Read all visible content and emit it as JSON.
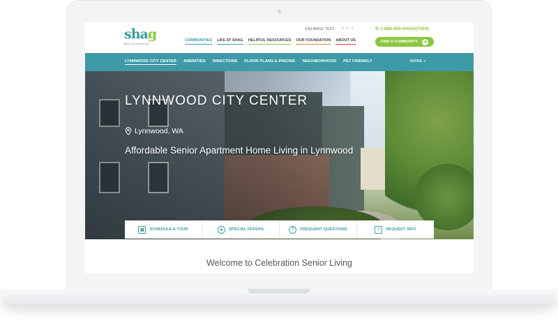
{
  "header": {
    "logo_main": "sha",
    "logo_accent": "g",
    "tagline": "Where you thrive to live",
    "enlarge_text": "ENLARGE TEXT",
    "text_sizes": "A A A",
    "phone": "1-888-450-SHAG(7424)",
    "find_button": "FIND A COMMUNITY",
    "find_arrow": "➔",
    "nav": [
      {
        "label": "COMMUNITIES"
      },
      {
        "label": "LIFE AT SHAG"
      },
      {
        "label": "HELPFUL RESOURCES"
      },
      {
        "label": "OUR FOUNDATION"
      },
      {
        "label": "ABOUT US"
      }
    ]
  },
  "subnav": {
    "items": [
      {
        "label": "LYNNWOOD CITY CENTER"
      },
      {
        "label": "AMENITIES"
      },
      {
        "label": "DIRECTIONS"
      },
      {
        "label": "FLOOR PLANS & PRICING"
      },
      {
        "label": "NEIGHBORHOOD"
      },
      {
        "label": "PET FRIENDLY"
      }
    ],
    "more": "MORE +"
  },
  "hero": {
    "title": "LYNNWOOD CITY CENTER",
    "location": "Lynnwood, WA",
    "subtitle": "Affordable Senior Apartment Home Living in Lynnwood"
  },
  "quick_links": [
    {
      "label": "SCHEDULE A TOUR",
      "icon": "calendar-icon",
      "glyph": "▦"
    },
    {
      "label": "SPECIAL OFFERS",
      "icon": "star-icon",
      "glyph": "★"
    },
    {
      "label": "FREQUENT QUESTIONS",
      "icon": "question-icon",
      "glyph": "?"
    },
    {
      "label": "REQUEST INFO",
      "icon": "clipboard-icon",
      "glyph": "≡"
    }
  ],
  "welcome": "Welcome to Celebration Senior Living",
  "colors": {
    "teal": "#3e9aa6",
    "green": "#8cc63f",
    "orange": "#e08a2c",
    "red": "#c9433f"
  }
}
